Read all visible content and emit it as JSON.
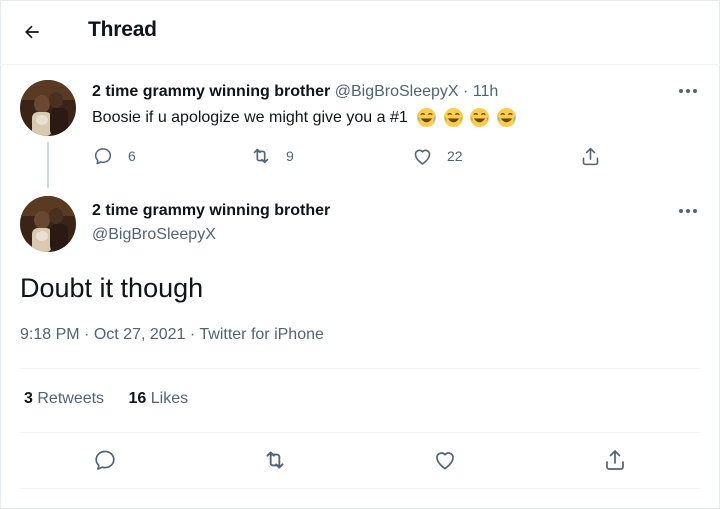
{
  "header": {
    "title": "Thread",
    "back_icon": "arrow-left-icon"
  },
  "reply_tweet": {
    "name": "2 time grammy winning brother",
    "handle": "@BigBroSleepyX",
    "separator": "·",
    "time": "11h",
    "text": "Boosie if u apologize we might give you a #1",
    "emojis": [
      "face-with-tears-of-joy",
      "face-with-tears-of-joy",
      "face-with-tears-of-joy",
      "face-with-tears-of-joy"
    ],
    "counts": {
      "replies": "6",
      "retweets": "9",
      "likes": "22"
    }
  },
  "main_tweet": {
    "name": "2 time grammy winning brother",
    "handle": "@BigBroSleepyX",
    "text": "Doubt it though",
    "time": "9:18 PM",
    "sep1": "·",
    "date": "Oct 27, 2021",
    "sep2": "·",
    "source": "Twitter for iPhone",
    "retweets_count": "3",
    "retweets_label": "Retweets",
    "likes_count": "16",
    "likes_label": "Likes"
  },
  "colors": {
    "text": "#0f1419",
    "muted": "#536471",
    "divider": "#eff3f4",
    "thread_line": "#cfd9de",
    "emoji": "#ffcc4d"
  }
}
